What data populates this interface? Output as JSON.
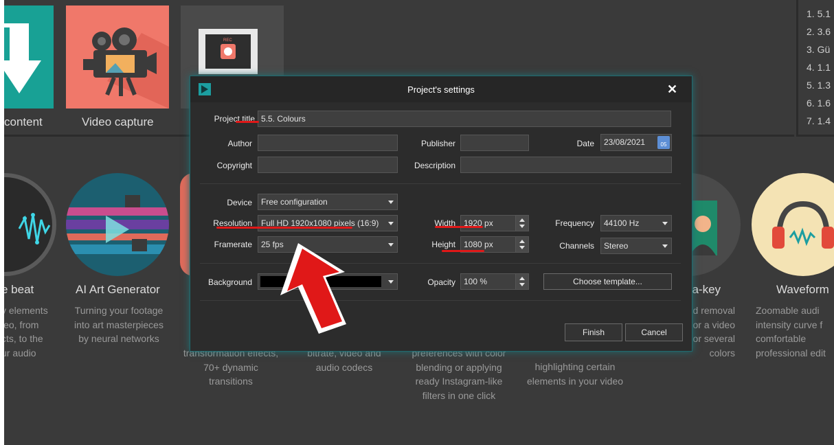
{
  "top_tiles": [
    {
      "label": "content"
    },
    {
      "label": "Video capture"
    }
  ],
  "right_list": [
    "1. 5.1",
    "2. 3.6",
    "3. Gü",
    "4. 1.1",
    "5. 1.3",
    "6. 1.6",
    "7. 1.4"
  ],
  "features": [
    {
      "title": "e beat",
      "desc": "y elements\nleo, from\ncts, to the\nur audio"
    },
    {
      "title": "AI Art Generator",
      "desc": "Turning your footage\ninto art masterpieces\nby neural networks"
    },
    {
      "title": "",
      "desc": "transformation effects,\n70+ dynamic\ntransitions"
    },
    {
      "title": "",
      "desc": "bitrate, video and\naudio codecs"
    },
    {
      "title": "",
      "desc": "preferences with color\nblending or applying\nready Instagram-like\nfilters in one click"
    },
    {
      "title": "",
      "desc": "highlighting certain\nelements in your video"
    },
    {
      "title": "na-key",
      "desc": "nd removal\ne or a video\nor several\ncolors"
    },
    {
      "title": "Waveform",
      "desc": "Zoomable audi\nintensity curve f\ncomfortable\nprofessional edit"
    }
  ],
  "dialog": {
    "title": "Project's settings",
    "close_glyph": "✕",
    "project_title_label": "Project title",
    "project_title_value": "5.5. Colours",
    "author_label": "Author",
    "author_value": "",
    "publisher_label": "Publisher",
    "publisher_value": "",
    "date_label": "Date",
    "date_value": "23/08/2021",
    "calendar_day": "05",
    "copyright_label": "Copyright",
    "copyright_value": "",
    "description_label": "Description",
    "description_value": "",
    "device_label": "Device",
    "device_value": "Free configuration",
    "resolution_label": "Resolution",
    "resolution_value": "Full HD 1920x1080 pixels (16:9)",
    "framerate_label": "Framerate",
    "framerate_value": "25 fps",
    "width_label": "Width",
    "width_value": "1920 px",
    "height_label": "Height",
    "height_value": "1080 px",
    "frequency_label": "Frequency",
    "frequency_value": "44100 Hz",
    "channels_label": "Channels",
    "channels_value": "Stereo",
    "background_label": "Background",
    "background_color": "#000000",
    "opacity_label": "Opacity",
    "opacity_value": "100 %",
    "choose_template_label": "Choose template...",
    "finish_label": "Finish",
    "cancel_label": "Cancel"
  },
  "colors": {
    "accent": "#1c9ea0",
    "annotation_red": "#e01818",
    "tile_teal": "#18a195",
    "tile_coral": "#f0786a"
  }
}
